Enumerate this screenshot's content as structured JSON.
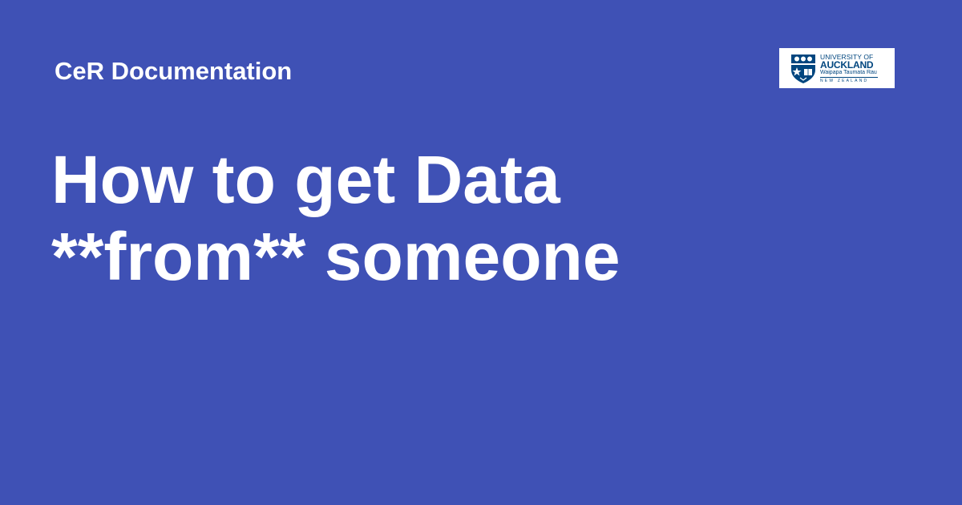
{
  "header": {
    "site_name": "CeR Documentation"
  },
  "main": {
    "title_line1": "How to get Data",
    "title_line2": "**from** someone"
  },
  "logo": {
    "line1": "UNIVERSITY OF",
    "line2": "AUCKLAND",
    "line3": "Waipapa Taumata Rau",
    "line4": "NEW ZEALAND"
  },
  "colors": {
    "background": "#3f51b5",
    "text": "#ffffff",
    "logo_blue": "#00467f"
  }
}
